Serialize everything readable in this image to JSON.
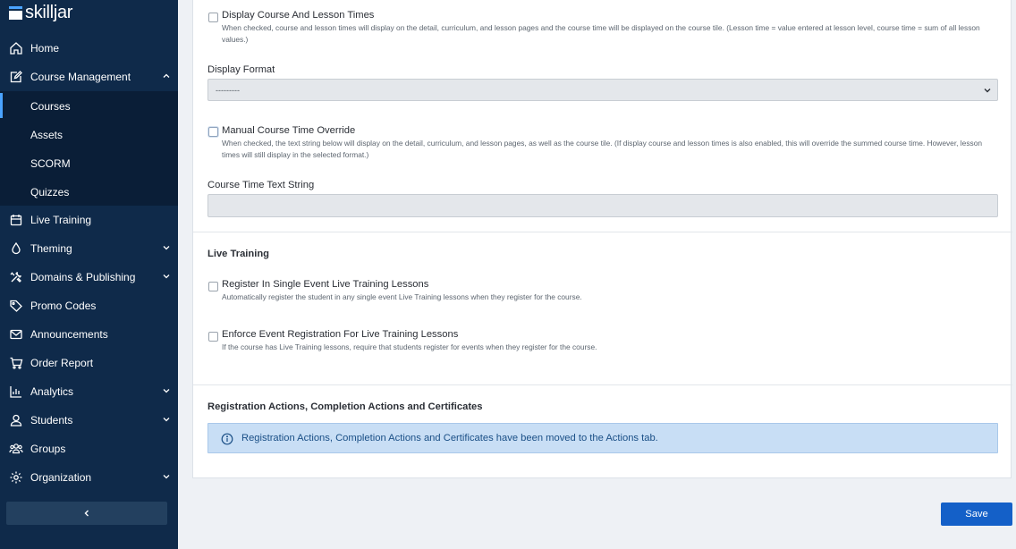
{
  "brand": {
    "logo_text": "skilljar"
  },
  "sidebar": {
    "items": [
      {
        "label": "Home",
        "icon": "home-icon"
      },
      {
        "label": "Course Management",
        "icon": "edit-icon"
      },
      {
        "label": "Live Training",
        "icon": "calendar-icon"
      },
      {
        "label": "Theming",
        "icon": "drop-icon"
      },
      {
        "label": "Domains & Publishing",
        "icon": "tools-icon"
      },
      {
        "label": "Promo Codes",
        "icon": "tag-icon"
      },
      {
        "label": "Announcements",
        "icon": "mail-icon"
      },
      {
        "label": "Order Report",
        "icon": "cart-icon"
      },
      {
        "label": "Analytics",
        "icon": "bar-chart-icon"
      },
      {
        "label": "Students",
        "icon": "user-icon"
      },
      {
        "label": "Groups",
        "icon": "group-icon"
      },
      {
        "label": "Organization",
        "icon": "gear-icon"
      }
    ],
    "course_management_sub": [
      {
        "label": "Courses"
      },
      {
        "label": "Assets"
      },
      {
        "label": "SCORM"
      },
      {
        "label": "Quizzes"
      }
    ],
    "collapse_icon": "chevron-left-icon"
  },
  "main": {
    "display_times": {
      "title": "Display Course And Lesson Times",
      "desc": "When checked, course and lesson times will display on the detail, curriculum, and lesson pages and the course time will be displayed on the course tile. (Lesson time = value entered at lesson level, course time = sum of all lesson values.)",
      "checked": false
    },
    "display_format": {
      "label": "Display Format",
      "value": "---------"
    },
    "manual_override": {
      "title": "Manual Course Time Override",
      "desc": "When checked, the text string below will display on the detail, curriculum, and lesson pages, as well as the course tile. (If display course and lesson times is also enabled, this will override the summed course time. However, lesson times will still display in the selected format.)",
      "checked": false
    },
    "time_text": {
      "label": "Course Time Text String",
      "value": ""
    },
    "live_training": {
      "title": "Live Training",
      "register": {
        "title": "Register In Single Event Live Training Lessons",
        "desc": "Automatically register the student in any single event Live Training lessons when they register for the course.",
        "checked": false
      },
      "enforce": {
        "title": "Enforce Event Registration For Live Training Lessons",
        "desc": "If the course has Live Training lessons, require that students register for events when they register for the course.",
        "checked": false
      }
    },
    "actions": {
      "title": "Registration Actions, Completion Actions and Certificates",
      "info": "Registration Actions, Completion Actions and Certificates have been moved to the Actions tab."
    }
  },
  "footer": {
    "save_label": "Save"
  },
  "colors": {
    "sidebar_bg": "#0f2a4a",
    "accent": "#1460c8",
    "info_bg": "#c8def5"
  }
}
